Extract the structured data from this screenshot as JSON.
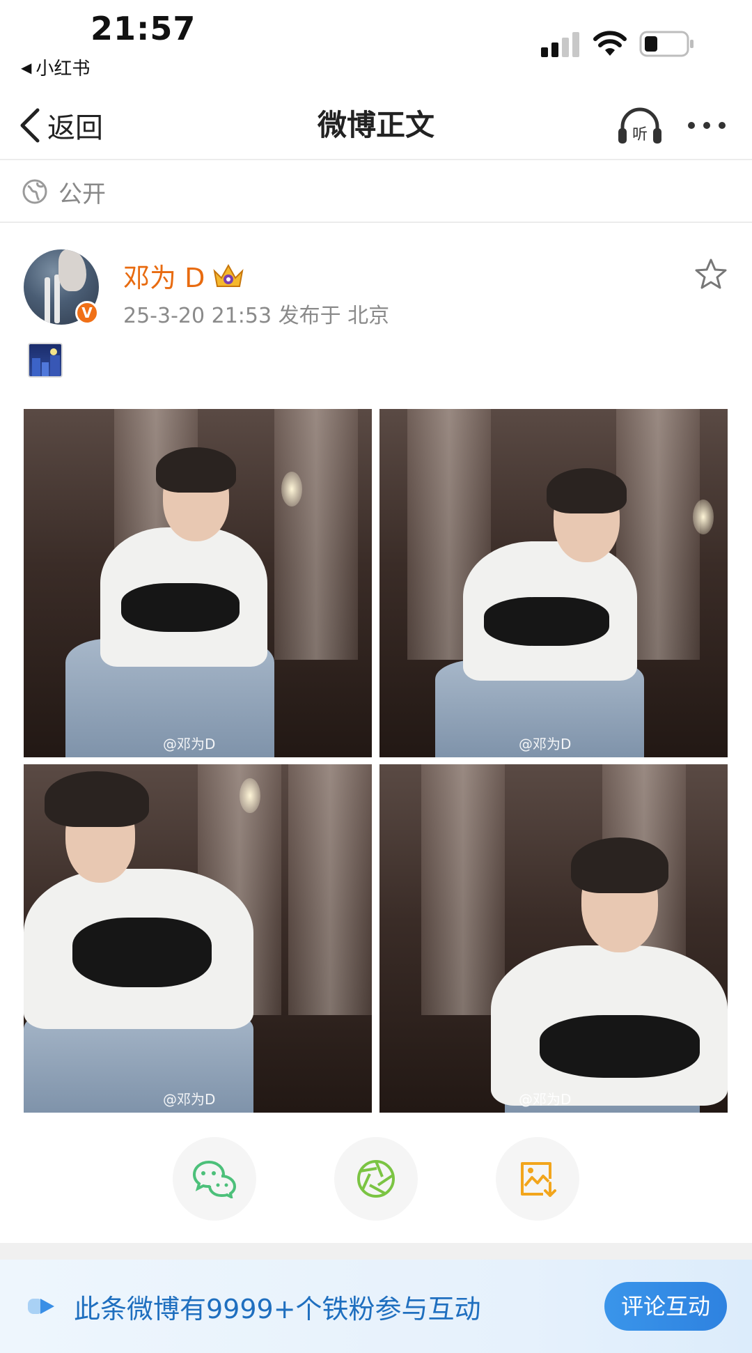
{
  "status_bar": {
    "time": "21:57",
    "back_app_label": "小红书"
  },
  "nav": {
    "back_label": "返回",
    "title": "微博正文",
    "listen_icon_text": "听"
  },
  "visibility": {
    "label": "公开"
  },
  "post": {
    "username": "邓为 D",
    "meta": "25-3-20 21:53  发布于 北京",
    "verified_badge": "V",
    "photos": [
      {
        "watermark": "@邓为D"
      },
      {
        "watermark": "@邓为D"
      },
      {
        "watermark": "@邓为D"
      },
      {
        "watermark": "@邓为D"
      }
    ]
  },
  "colors": {
    "username": "#e86b10",
    "accent_blue": "#2e82e0",
    "wechat_green": "#4cc07a",
    "moments_green": "#7bc443",
    "save_orange": "#f2a51c"
  },
  "share": {
    "icons": [
      "wechat-icon",
      "moments-icon",
      "save-image-icon"
    ]
  },
  "fan_banner": {
    "text": "此条微博有9999+个铁粉参与互动",
    "button_label": "评论互动"
  }
}
